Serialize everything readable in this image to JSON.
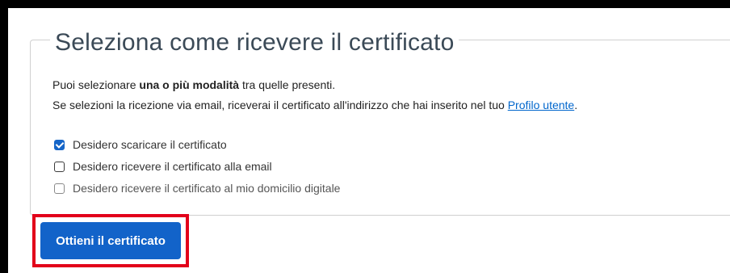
{
  "section": {
    "title": "Seleziona come ricevere il certificato",
    "intro_prefix": "Puoi selezionare ",
    "intro_bold": "una o più modalità",
    "intro_suffix": " tra quelle presenti.",
    "email_note_prefix": "Se selezioni la ricezione via email, riceverai il certificato all'indirizzo che hai inserito nel tuo ",
    "profile_link": "Profilo utente",
    "email_note_suffix": "."
  },
  "options": [
    {
      "label": "Desidero scaricare il certificato",
      "checked": true,
      "disabled": false
    },
    {
      "label": "Desidero ricevere il certificato alla email",
      "checked": false,
      "disabled": false
    },
    {
      "label": "Desidero ricevere il certificato al mio domicilio digitale",
      "checked": false,
      "disabled": true
    }
  ],
  "submit": {
    "label": "Ottieni il certificato"
  },
  "colors": {
    "primary": "#1263c9",
    "highlight": "#e2001a",
    "link": "#0066cc"
  }
}
